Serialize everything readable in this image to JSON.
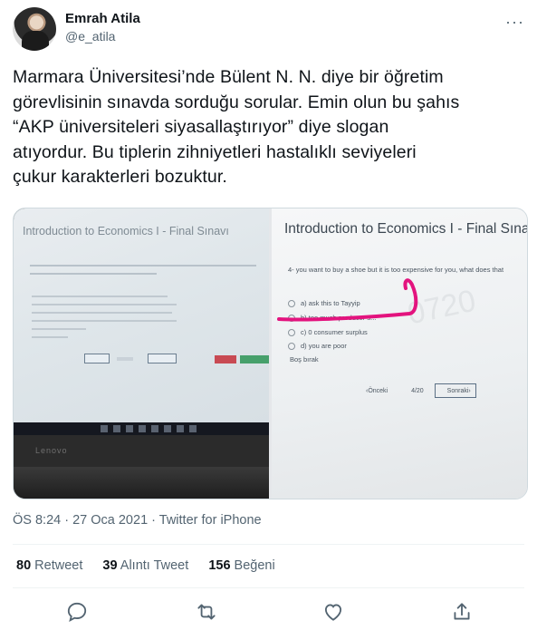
{
  "user": {
    "name": "Emrah Atila",
    "handle": "@e_atila",
    "more": "···"
  },
  "tweet": {
    "text": "Marmara Üniversitesi’nde Bülent N. N. diye bir öğretim\ngörevlisinin sınavda sorduğu sorular. Emin olun bu şahıs\n“AKP üniversiteleri siyasallaştırıyor” diye slogan\natıyordur. Bu tiplerin zihniyetleri hastalıklı seviyeleri\nçukur karakterleri bozuktur."
  },
  "media": {
    "left": {
      "screen_title": "Introduction to Economics I - Final Sınavı",
      "brand": "Lenovo"
    },
    "right": {
      "screen_title": "Introduction to Economics I - Final Sınavı",
      "question": "4-  you want to buy a shoe but it is too expensive for you, what does that",
      "options": [
        "a)   ask this to Tayyip",
        "b)   too much producer s...",
        "c)   0 consumer surplus",
        "d)   you are poor",
        "      Boş bırak"
      ],
      "prev": "‹Önceki",
      "page": "4/20",
      "next": "Sonraki›",
      "highlight_color": "#e3137e"
    }
  },
  "meta": {
    "time": "ÖS 8:24",
    "date": "27 Oca 2021",
    "source": "Twitter for iPhone"
  },
  "stats": {
    "retweets": "80",
    "retweets_label": "Retweet",
    "quotes": "39",
    "quotes_label": "Alıntı Tweet",
    "likes": "156",
    "likes_label": "Beğeni"
  },
  "actions": {
    "reply_icon": "reply-icon",
    "retweet_icon": "retweet-icon",
    "like_icon": "heart-icon",
    "share_icon": "share-icon"
  }
}
